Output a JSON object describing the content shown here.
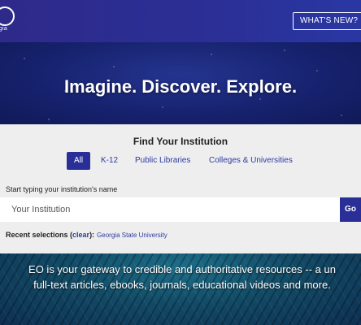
{
  "header": {
    "logo_sub": "orgia",
    "whats_new_label": "WHAT'S NEW?"
  },
  "hero": {
    "tagline": "Imagine. Discover. Explore."
  },
  "finder": {
    "title": "Find Your Institution",
    "tabs": [
      {
        "label": "All",
        "active": true
      },
      {
        "label": "K-12",
        "active": false
      },
      {
        "label": "Public Libraries",
        "active": false
      },
      {
        "label": "Colleges & Universities",
        "active": false
      }
    ],
    "input_label": "Start typing your institution's name",
    "input_placeholder": "Your Institution",
    "go_label": "Go",
    "recent_label": "Recent selections (",
    "clear_label": "clear",
    "recent_suffix": "):",
    "recent_item": "Georgia State University"
  },
  "description": {
    "line1": "EO is your gateway to credible and authoritative resources -- a un",
    "line2": "full-text articles, ebooks, journals, educational videos and more."
  },
  "colors": {
    "brand": "#2a2f97",
    "link": "#2d3aa3",
    "panel_bg": "#eeeeee"
  }
}
